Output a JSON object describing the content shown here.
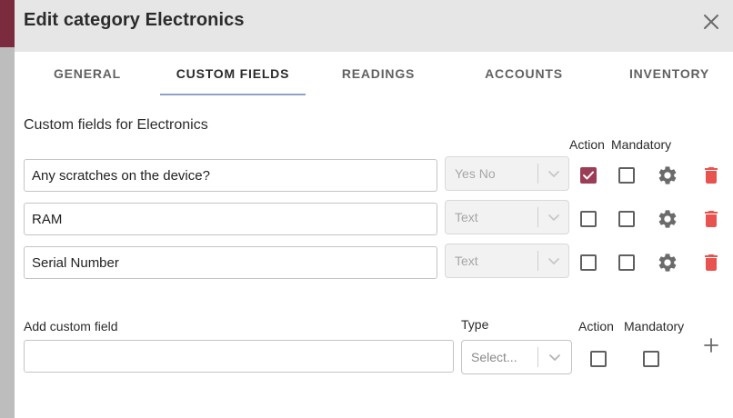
{
  "modal": {
    "title": "Edit category Electronics",
    "close_icon": "close-icon"
  },
  "tabs": [
    {
      "label": "GENERAL",
      "active": false
    },
    {
      "label": "CUSTOM FIELDS",
      "active": true
    },
    {
      "label": "READINGS",
      "active": false
    },
    {
      "label": "ACCOUNTS",
      "active": false
    },
    {
      "label": "INVENTORY",
      "active": false
    }
  ],
  "custom_fields": {
    "section_title": "Custom fields for Electronics",
    "column_action": "Action",
    "column_mandatory": "Mandatory",
    "rows": [
      {
        "name": "Any scratches on the device?",
        "type": "Yes No",
        "action": true,
        "mandatory": false
      },
      {
        "name": "RAM",
        "type": "Text",
        "action": false,
        "mandatory": false
      },
      {
        "name": "Serial Number",
        "type": "Text",
        "action": false,
        "mandatory": false
      }
    ],
    "settings_icon": "gear-icon",
    "delete_icon": "trash-icon"
  },
  "add_field": {
    "name_label": "Add custom field",
    "name_value": "",
    "type_label": "Type",
    "type_placeholder": "Select...",
    "action_label": "Action",
    "mandatory_label": "Mandatory",
    "action": false,
    "mandatory": false,
    "add_icon": "plus-icon"
  },
  "colors": {
    "accent": "#9c3d57",
    "tab_indicator": "#8fa3c8",
    "delete": "#e8534f",
    "icon_gray": "#6b6b6b",
    "header_bg": "#e6e6e6"
  }
}
